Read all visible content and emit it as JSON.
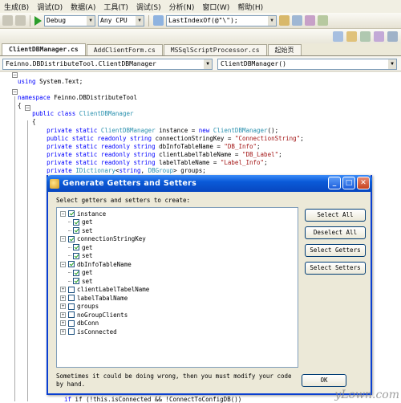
{
  "menu": [
    "生成(B)",
    "调试(D)",
    "数据(A)",
    "工具(T)",
    "调试(S)",
    "分析(N)",
    "窗口(W)",
    "帮助(H)"
  ],
  "toolbar": {
    "config": "Debug",
    "platform": "Any CPU",
    "find": "LastIndexOf(@\"\\\");"
  },
  "tabs": [
    {
      "label": "ClientDBManager.cs",
      "active": true
    },
    {
      "label": "AddClientForm.cs",
      "active": false
    },
    {
      "label": "MSSqlScriptProcessor.cs",
      "active": false
    },
    {
      "label": "起始页",
      "active": false
    }
  ],
  "nav": {
    "type": "Feinno.DBDistributeTool.ClientDBManager",
    "member": "ClientDBManager()"
  },
  "code_lines": [
    "using System.Text;",
    "",
    "namespace Feinno.DBDistributeTool",
    "{",
    "    public class ClientDBManager",
    "    {",
    "        private static ClientDBManager instance = new ClientDBManager();",
    "        public static readonly string connectionStringKey = \"ConnectionString\";",
    "        private static readonly string dbInfoTableName = \"DB_Info\";",
    "        private static readonly string clientLabelTableName = \"DB_Label\";",
    "        private static readonly string labelTableName = \"Label_Info\";",
    "        private IDictionary<string, DBGroup> groups;"
  ],
  "bottom_code": "if (!this.isConnected && !ConnectToConfigDB())",
  "dialog": {
    "title": "Generate Getters and Setters",
    "prompt": "Select getters and setters to create:",
    "tree": [
      {
        "label": "instance",
        "level": 0,
        "checked": true,
        "expanded": true
      },
      {
        "label": "get",
        "level": 1,
        "checked": true
      },
      {
        "label": "set",
        "level": 1,
        "checked": true
      },
      {
        "label": "connectionStringKey",
        "level": 0,
        "checked": true,
        "expanded": true
      },
      {
        "label": "get",
        "level": 1,
        "checked": true
      },
      {
        "label": "set",
        "level": 1,
        "checked": true
      },
      {
        "label": "dbInfoTableName",
        "level": 0,
        "checked": true,
        "expanded": true
      },
      {
        "label": "get",
        "level": 1,
        "checked": true
      },
      {
        "label": "set",
        "level": 1,
        "checked": true
      },
      {
        "label": "clientLabelTabelName",
        "level": 0,
        "checked": false,
        "expanded": false
      },
      {
        "label": "labelTabalName",
        "level": 0,
        "checked": false,
        "expanded": false
      },
      {
        "label": "groups",
        "level": 0,
        "checked": false,
        "expanded": false
      },
      {
        "label": "noGroupClients",
        "level": 0,
        "checked": false,
        "expanded": false
      },
      {
        "label": "dbConn",
        "level": 0,
        "checked": false,
        "expanded": false
      },
      {
        "label": "isConnected",
        "level": 0,
        "checked": false,
        "expanded": false
      }
    ],
    "buttons": [
      "Select All",
      "Deselect All",
      "Select Getters",
      "Select Setters"
    ],
    "note": "Sometimes it could be doing wrong, then you must modify your code by hand.",
    "ok": "OK"
  },
  "watermark": "yLown.com"
}
